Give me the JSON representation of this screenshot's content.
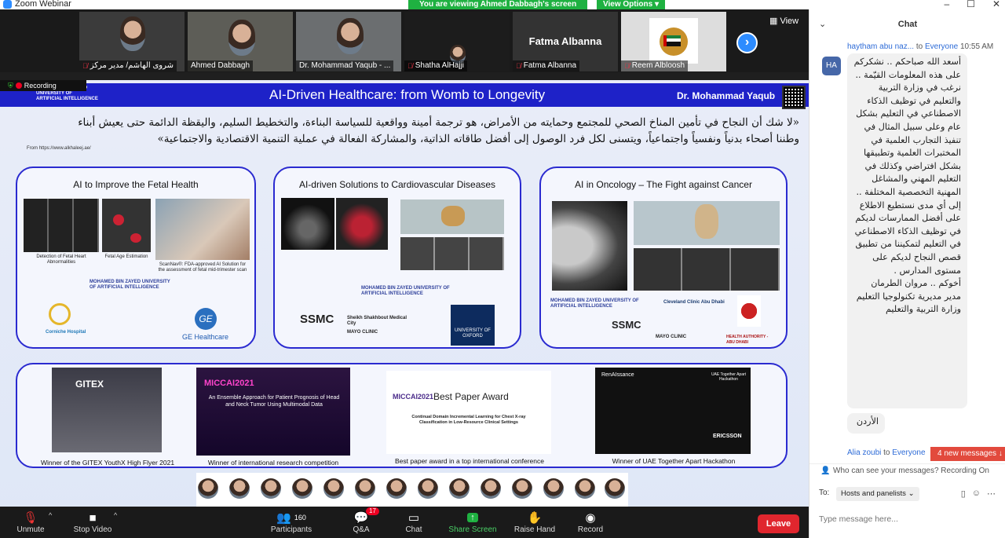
{
  "window": {
    "title": "Zoom Webinar",
    "banner": "You are viewing Ahmed Dabbagh's screen",
    "view_options": "View Options"
  },
  "gallery": {
    "participants": [
      {
        "name": "شروى الهاشم/ مدير مركز",
        "muted": true
      },
      {
        "name": "Ahmed Dabbagh",
        "muted": false
      },
      {
        "name": "Dr. Mohammad Yaqub - ...",
        "muted": false
      },
      {
        "name": "Shatha AlHajji",
        "muted": true
      },
      {
        "name": "Fatma Albanna",
        "muted": true,
        "card_text": "Fatma Albanna"
      },
      {
        "name": "Reem Albloosh",
        "muted": true
      }
    ],
    "view_label": "View",
    "next_label": "›"
  },
  "slide": {
    "recording": "Recording",
    "university": "MOHAMED BIN ZAYED UNIVERSITY OF ARTIFICIAL INTELLIGENCE",
    "title": "AI-Driven Healthcare: from Womb to Longevity",
    "author": "Dr. Mohammad Yaqub",
    "quote_line1": "«لا شك أن النجاح في تأمين المناخ الصحي للمجتمع وحمايته من الأمراض، هو ترجمة أمينة وواقعية للسياسة البناءة، والتخطيط السليم، واليقظة الدائمة حتى يعيش أبناء",
    "quote_line2": "وطننا أصحاء بدنياً ونفسياً واجتماعياً، ويتسنى لكل فرد الوصول إلى أفضل طاقاته الذاتية، والمشاركة الفعالة في عملية التنمية الاقتصادية والاجتماعية»",
    "quote_source": "From https://www.alkhaleej.ae/",
    "panels": [
      {
        "title": "AI to Improve the Fetal Health",
        "captions": [
          "Detection of Fetal Heart Abnormalities",
          "Fetal Age Estimation",
          "ScanNav®: FDA-approved AI Solution for the assessment of fetal mid-trimester scan"
        ],
        "logos": [
          "MOHAMED BIN ZAYED UNIVERSITY OF ARTIFICIAL INTELLIGENCE",
          "Corniche Hospital",
          "GE Healthcare"
        ]
      },
      {
        "title": "AI-driven Solutions to Cardiovascular Diseases",
        "logos": [
          "MOHAMED BIN ZAYED UNIVERSITY OF ARTIFICIAL INTELLIGENCE",
          "SSMC",
          "Sheikh Shakhbout Medical City",
          "MAYO CLINIC",
          "UNIVERSITY OF OXFORD"
        ]
      },
      {
        "title": "AI in Oncology – The Fight against Cancer",
        "logos": [
          "MOHAMED BIN ZAYED UNIVERSITY OF ARTIFICIAL INTELLIGENCE",
          "Cleveland Clinic Abu Dhabi",
          "SSMC",
          "MAYO CLINIC",
          "HEALTH AUTHORITY - ABU DHABI"
        ]
      }
    ],
    "awards": [
      {
        "caption": "Winner of the GITEX YouthX High Flyer 2021",
        "img_text": "GITEX"
      },
      {
        "caption": "Winner of international research competition",
        "img_text": "An Ensemble Approach for Patient Prognosis of Head and Neck Tumor Using Multimodal Data",
        "img_brand": "MICCAI2021"
      },
      {
        "caption": "Best paper award in a top international conference",
        "img_text": "Best Paper Award",
        "img_sub": "Continual Domain Incremental Learning for Chest X-ray Classification in Low-Resource Clinical Settings",
        "img_brand": "MICCAI2021"
      },
      {
        "caption": "Winner of UAE Together Apart Hackathon",
        "img_text": "RenAIssance",
        "img_sub": "UAE Together Apart Hackathon",
        "img_brand": "ERICSSON"
      }
    ]
  },
  "controls": {
    "unmute": "Unmute",
    "stop_video": "Stop Video",
    "participants": "Participants",
    "participants_count": "160",
    "qa": "Q&A",
    "qa_badge": "17",
    "chat": "Chat",
    "share_screen": "Share Screen",
    "raise_hand": "Raise Hand",
    "record": "Record",
    "leave": "Leave"
  },
  "chat": {
    "title": "Chat",
    "messages": [
      {
        "sender": "haytham abu naz...",
        "to_label": "to",
        "to": "Everyone",
        "time": "10:55 AM",
        "avatar": "HA",
        "text": "أسعد الله صباحكم .. نشكركم على هذه المعلومات القيّمة .. نرغب في وزارة التربية والتعليم في توظيف الذكاء الاصطناعي في التعليم بشكل عام وعلى سبيل المثال في تنفيذ التجارب العلمية في المختبرات العلمية وتطبيقها بشكل افتراضي وكذلك في التعليم المهني والمشاغل المهنية التخصصية المختلفة .. إلى أي مدى نستطيع الاطلاع على أفضل الممارسات لديكم في توظيف الذكاء الاصطناعي في التعليم لتمكيننا من تطبيق قصص النجاح لديكم على مستوى المدارس .",
        "text2": "أخوكم .. مروان الطرمان مدير مديرية تكنولوجيا التعليم وزارة التربية والتعليم",
        "text3": "الأردن"
      },
      {
        "sender": "Alia zoubi",
        "to_label": "to",
        "to": "Everyone"
      }
    ],
    "new_messages": "4 new messages ↓",
    "privacy_note": "Who can see your messages? Recording On",
    "to_label": "To:",
    "to_value": "Hosts and panelists",
    "placeholder": "Type message here..."
  }
}
